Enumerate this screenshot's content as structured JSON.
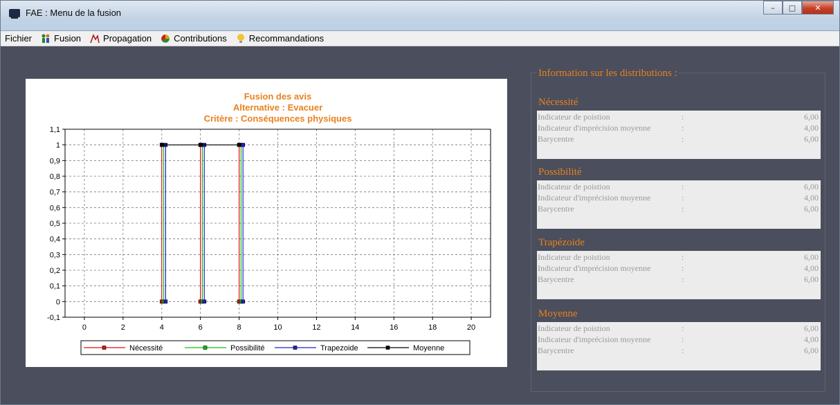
{
  "window": {
    "title": "FAE : Menu de la fusion"
  },
  "menu": {
    "items": [
      {
        "label": "Fichier"
      },
      {
        "label": "Fusion"
      },
      {
        "label": "Propagation"
      },
      {
        "label": "Contributions"
      },
      {
        "label": "Recommandations"
      }
    ]
  },
  "info": {
    "title": "Information sur les distributions :",
    "sections": [
      {
        "name": "Nécessité",
        "rows": [
          {
            "label": "Indicateur de poistion",
            "colon": ":",
            "value": "6,00"
          },
          {
            "label": "Indicateur d'imprécision moyenne",
            "colon": ":",
            "value": "4,00"
          },
          {
            "label": "Barycentre",
            "colon": ":",
            "value": "6,00"
          }
        ]
      },
      {
        "name": "Possibilité",
        "rows": [
          {
            "label": "Indicateur de poistion",
            "colon": ":",
            "value": "6,00"
          },
          {
            "label": "Indicateur d'imprécision moyenne",
            "colon": ":",
            "value": "4,00"
          },
          {
            "label": "Barycentre",
            "colon": ":",
            "value": "6,00"
          }
        ]
      },
      {
        "name": "Trapézoide",
        "rows": [
          {
            "label": "Indicateur de poistion",
            "colon": ":",
            "value": "6,00"
          },
          {
            "label": "Indicateur d'imprécision moyenne",
            "colon": ":",
            "value": "4,00"
          },
          {
            "label": "Barycentre",
            "colon": ":",
            "value": "6,00"
          }
        ]
      },
      {
        "name": "Moyenne",
        "rows": [
          {
            "label": "Indicateur de poistion",
            "colon": ":",
            "value": "6,00"
          },
          {
            "label": "Indicateur d'imprécision moyenne",
            "colon": ":",
            "value": "4,00"
          },
          {
            "label": "Barycentre",
            "colon": ":",
            "value": "6,00"
          }
        ]
      }
    ]
  },
  "colors": {
    "accent": "#e8821e",
    "background": "#4b4e5c"
  },
  "chart_data": {
    "type": "line",
    "title": [
      "Fusion des avis",
      "Alternative : Evacuer",
      "Critère : Conséquences physiques"
    ],
    "xlim": [
      -1,
      21
    ],
    "ylim": [
      -0.1,
      1.1
    ],
    "x_ticks": [
      0,
      2,
      4,
      6,
      8,
      10,
      12,
      14,
      16,
      18,
      20
    ],
    "x_tick_labels": [
      "0",
      "2",
      "4",
      "6",
      "8",
      "10",
      "12",
      "14",
      "16",
      "18",
      "20"
    ],
    "y_ticks": [
      -0.1,
      0,
      0.1,
      0.2,
      0.3,
      0.4,
      0.5,
      0.6,
      0.7,
      0.8,
      0.9,
      1,
      1.1
    ],
    "y_tick_labels": [
      "-0,1",
      "0",
      "0,1",
      "0,2",
      "0,3",
      "0,4",
      "0,5",
      "0,6",
      "0,7",
      "0,8",
      "0,9",
      "1",
      "1,1"
    ],
    "grid": true,
    "legend_position": "bottom",
    "series": [
      {
        "name": "Nécessité",
        "color": "#e01010",
        "x": [
          4,
          4,
          6,
          6,
          8,
          8
        ],
        "y": [
          0,
          1,
          0,
          1,
          0,
          1
        ]
      },
      {
        "name": "Possibilité",
        "color": "#10c010",
        "x": [
          4.1,
          4.1,
          6.1,
          6.1,
          8.1,
          8.1
        ],
        "y": [
          0,
          1,
          0,
          1,
          0,
          1
        ]
      },
      {
        "name": "Trapezoide",
        "color": "#2020c8",
        "x": [
          4.2,
          4.2,
          6.2,
          6.2,
          8.2,
          8.2
        ],
        "y": [
          0,
          1,
          0,
          1,
          0,
          1
        ]
      },
      {
        "name": "Moyenne",
        "color": "#000000",
        "x": [
          4,
          6,
          8
        ],
        "y": [
          1,
          1,
          1
        ]
      }
    ]
  }
}
